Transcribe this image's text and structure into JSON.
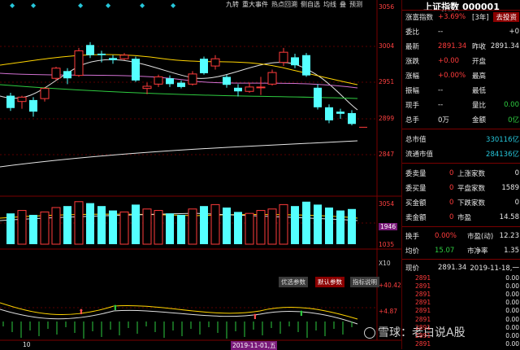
{
  "toolbar": {
    "tabs": [
      "九转",
      "重大事件",
      "热点回溯",
      "侧自选",
      "均线",
      "叠",
      "预测"
    ]
  },
  "price_axis": [
    "3056",
    "3004",
    "2951",
    "2899",
    "2847"
  ],
  "volume_axis": [
    "3054",
    "1946",
    "1035",
    "X10"
  ],
  "indicator_axis": [
    "+40.42",
    "+4.87"
  ],
  "bottom": {
    "date_label": "2019-11-01,五",
    "x_tick": "10"
  },
  "indicator_buttons": {
    "optimize": "优选参数",
    "default": "默认参数",
    "explain": "指标说明"
  },
  "header": {
    "title": "上证指数 000001"
  },
  "quote": {
    "rows": [
      {
        "l": "涨富指数",
        "v": "+3.69%",
        "x": "[3年]",
        "r": "去投资"
      },
      {
        "l": "委比",
        "v": "--",
        "x": "",
        "r": "+0"
      },
      {
        "l": "最新",
        "v": "2891.34",
        "x": "昨收",
        "r": "2891.34"
      },
      {
        "l": "涨跌",
        "v": "+0.00",
        "x": "开盘",
        "r": ""
      },
      {
        "l": "涨幅",
        "v": "+0.00%",
        "x": "最高",
        "r": ""
      },
      {
        "l": "振幅",
        "v": "--",
        "x": "最低",
        "r": ""
      },
      {
        "l": "现手",
        "v": "--",
        "x": "量比",
        "r": "0.00"
      },
      {
        "l": "总手",
        "v": "0万",
        "x": "金额",
        "r": "0亿"
      }
    ],
    "market": [
      {
        "l": "总市值",
        "v": "330116亿"
      },
      {
        "l": "流通市值",
        "v": "284136亿"
      }
    ],
    "breadth": [
      {
        "l": "委卖量",
        "v": "0",
        "x": "上涨家数",
        "r": "0"
      },
      {
        "l": "委买量",
        "v": "0",
        "x": "平盘家数",
        "r": "1589"
      },
      {
        "l": "买金额",
        "v": "0",
        "x": "下跌家数",
        "r": "0"
      },
      {
        "l": "卖金额",
        "v": "0",
        "x": "市盈",
        "r": "14.58"
      }
    ],
    "extra": [
      {
        "l": "换手",
        "v": "0.00%",
        "x": "市盈(动)",
        "r": "12.23"
      },
      {
        "l": "均价",
        "v": "15.07",
        "x": "市净率",
        "r": "1.35"
      }
    ]
  },
  "ticks": {
    "header": {
      "l": "现价",
      "v": "2891.34",
      "r": "2019-11-18,一"
    },
    "rows": [
      "2891",
      "2891",
      "2891",
      "2891",
      "2891",
      "2891",
      "2891",
      "2891",
      "2891"
    ],
    "row_right": "0.00"
  },
  "watermark": "雪球：老白说A股",
  "chart_data": {
    "type": "candlestick",
    "candles": [
      {
        "o": 2934,
        "c": 2917,
        "h": 2938,
        "l": 2913
      },
      {
        "o": 2926,
        "c": 2932,
        "h": 2934,
        "l": 2916
      },
      {
        "o": 2928,
        "c": 2912,
        "h": 2932,
        "l": 2905
      },
      {
        "o": 2930,
        "c": 2944,
        "h": 2946,
        "l": 2926
      },
      {
        "o": 2958,
        "c": 2972,
        "h": 2974,
        "l": 2955
      },
      {
        "o": 2968,
        "c": 2958,
        "h": 2972,
        "l": 2950
      },
      {
        "o": 2962,
        "c": 2996,
        "h": 3000,
        "l": 2960
      },
      {
        "o": 3004,
        "c": 2990,
        "h": 3008,
        "l": 2986
      },
      {
        "o": 2992,
        "c": 2990,
        "h": 2996,
        "l": 2980
      },
      {
        "o": 2986,
        "c": 2983,
        "h": 2990,
        "l": 2978
      },
      {
        "o": 2985,
        "c": 2990,
        "h": 2993,
        "l": 2983
      },
      {
        "o": 2985,
        "c": 2955,
        "h": 2988,
        "l": 2953
      },
      {
        "o": 2944,
        "c": 2947,
        "h": 2952,
        "l": 2936
      },
      {
        "o": 2950,
        "c": 2960,
        "h": 2963,
        "l": 2946
      },
      {
        "o": 2958,
        "c": 2950,
        "h": 2962,
        "l": 2946
      },
      {
        "o": 2952,
        "c": 2946,
        "h": 2955,
        "l": 2944
      },
      {
        "o": 2950,
        "c": 2964,
        "h": 2968,
        "l": 2948
      },
      {
        "o": 2985,
        "c": 2965,
        "h": 2988,
        "l": 2963
      },
      {
        "o": 2975,
        "c": 2985,
        "h": 2990,
        "l": 2970
      },
      {
        "o": 2960,
        "c": 2949,
        "h": 2963,
        "l": 2945
      },
      {
        "o": 2945,
        "c": 2940,
        "h": 2950,
        "l": 2933
      },
      {
        "o": 2940,
        "c": 2946,
        "h": 2952,
        "l": 2938
      },
      {
        "o": 2945,
        "c": 2946,
        "h": 2960,
        "l": 2935
      },
      {
        "o": 2950,
        "c": 2966,
        "h": 2970,
        "l": 2948
      },
      {
        "o": 2980,
        "c": 2994,
        "h": 3000,
        "l": 2975
      },
      {
        "o": 2987,
        "c": 2976,
        "h": 2992,
        "l": 2972
      },
      {
        "o": 2990,
        "c": 2962,
        "h": 2993,
        "l": 2960
      },
      {
        "o": 2945,
        "c": 2918,
        "h": 2950,
        "l": 2915
      },
      {
        "o": 2918,
        "c": 2900,
        "h": 2922,
        "l": 2896
      },
      {
        "o": 2912,
        "c": 2909,
        "h": 2916,
        "l": 2902
      },
      {
        "o": 2910,
        "c": 2895,
        "h": 2914,
        "l": 2893
      },
      {
        "o": 2891,
        "c": 2891,
        "h": 2891,
        "l": 2891
      }
    ],
    "volume": [
      2100,
      2300,
      2000,
      2200,
      2500,
      2600,
      2900,
      2800,
      2600,
      2300,
      2200,
      2700,
      2400,
      2300,
      2100,
      2000,
      2400,
      2600,
      2700,
      2500,
      2200,
      2100,
      2300,
      2400,
      2700,
      2600,
      2900,
      2700,
      2500,
      2300,
      2400,
      0
    ]
  }
}
